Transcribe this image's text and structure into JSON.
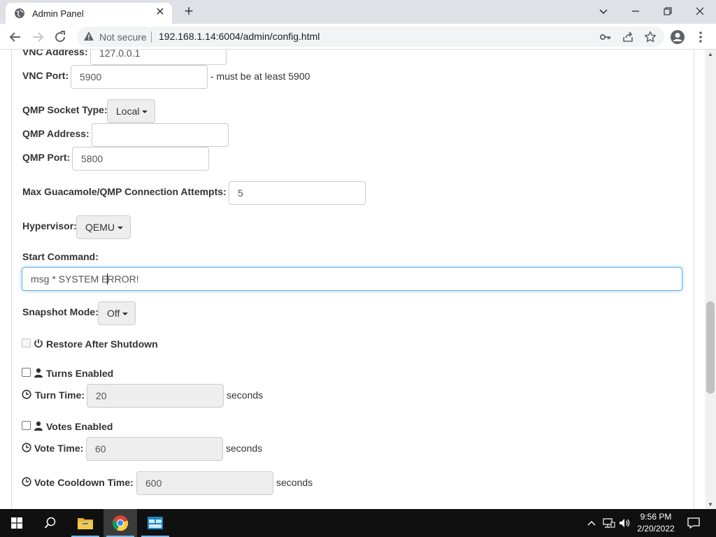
{
  "browser": {
    "tab_title": "Admin Panel",
    "security_label": "Not secure",
    "url": "192.168.1.14:6004/admin/config.html"
  },
  "form": {
    "vnc_address_label": "VNC Address:",
    "vnc_address_value": "127.0.0.1",
    "vnc_port_label": "VNC Port:",
    "vnc_port_value": "5900",
    "vnc_port_hint": "- must be at least 5900",
    "qmp_socket_type_label": "QMP Socket Type:",
    "qmp_socket_type_value": "Local",
    "qmp_address_label": "QMP Address:",
    "qmp_address_value": "",
    "qmp_port_label": "QMP Port:",
    "qmp_port_value": "5800",
    "max_attempts_label": "Max Guacamole/QMP Connection Attempts:",
    "max_attempts_value": "5",
    "hypervisor_label": "Hypervisor:",
    "hypervisor_value": "QEMU",
    "start_command_label": "Start Command:",
    "start_command_before_caret": "msg * SYSTEM E",
    "start_command_after_caret": "RROR!",
    "snapshot_mode_label": "Snapshot Mode:",
    "snapshot_mode_value": "Off",
    "restore_after_shutdown_label": "Restore After Shutdown",
    "turns_enabled_label": "Turns Enabled",
    "turn_time_label": "Turn Time:",
    "turn_time_value": "20",
    "turn_time_unit": "seconds",
    "votes_enabled_label": "Votes Enabled",
    "vote_time_label": "Vote Time:",
    "vote_time_value": "60",
    "vote_time_unit": "seconds",
    "vote_cooldown_label": "Vote Cooldown Time:",
    "vote_cooldown_value": "600",
    "vote_cooldown_unit": "seconds"
  },
  "taskbar": {
    "time": "9:56 PM",
    "date": "2/20/2022"
  },
  "colors": {
    "focus_border": "#66afe9",
    "taskbar_bg": "#101010",
    "tabbar_bg": "#dee1e6"
  }
}
